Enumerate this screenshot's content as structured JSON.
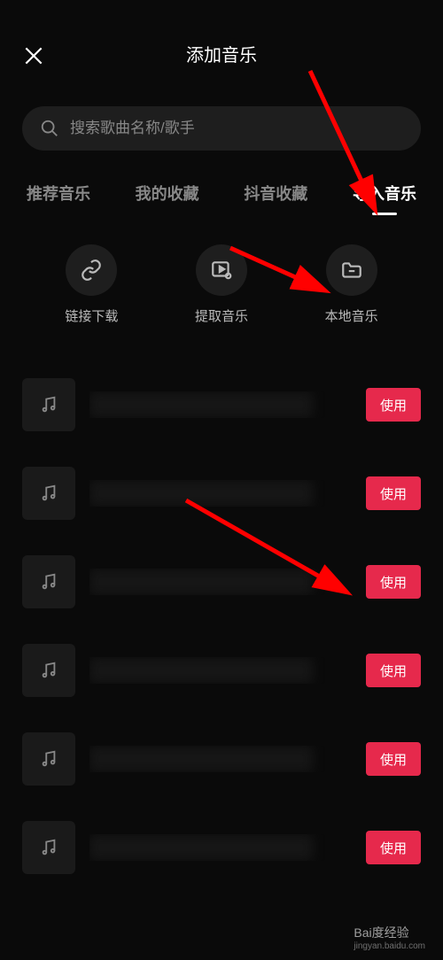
{
  "header": {
    "title": "添加音乐"
  },
  "search": {
    "placeholder": "搜索歌曲名称/歌手"
  },
  "tabs": [
    {
      "label": "推荐音乐",
      "active": false
    },
    {
      "label": "我的收藏",
      "active": false
    },
    {
      "label": "抖音收藏",
      "active": false
    },
    {
      "label": "导入音乐",
      "active": true
    }
  ],
  "import_options": [
    {
      "icon": "link-icon",
      "label": "链接下载"
    },
    {
      "icon": "extract-icon",
      "label": "提取音乐"
    },
    {
      "icon": "folder-icon",
      "label": "本地音乐"
    }
  ],
  "use_label": "使用",
  "songs": [
    {},
    {},
    {},
    {},
    {},
    {}
  ],
  "watermark": {
    "main": "Bai度经验",
    "sub": "jingyan.baidu.com"
  },
  "accent_color": "#e6294c"
}
